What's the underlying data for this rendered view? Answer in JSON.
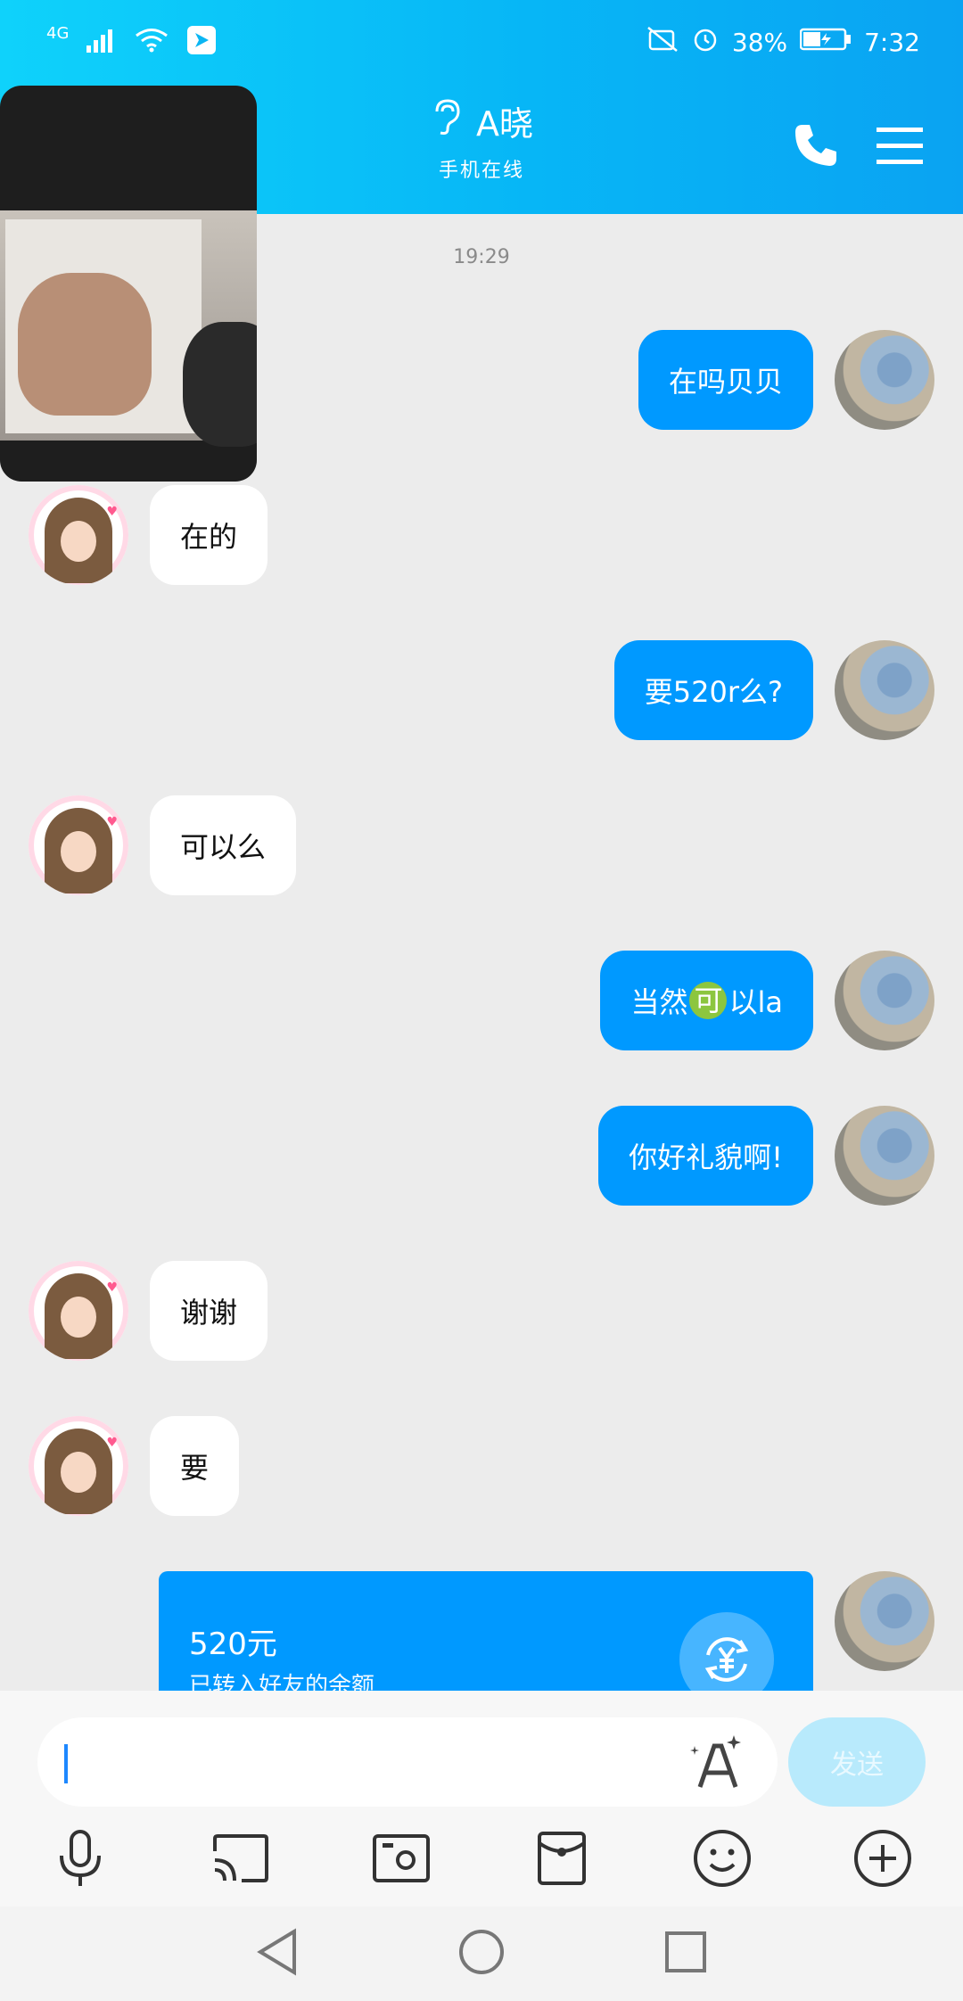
{
  "status_bar": {
    "network": "4G",
    "battery": "38%",
    "time": "7:32"
  },
  "header": {
    "contact_name": "A晓",
    "status": "手机在线",
    "icons": [
      "ear-icon",
      "phone-icon",
      "menu-icon"
    ]
  },
  "chat": {
    "timestamp": "19:29",
    "messages": [
      {
        "from": "me",
        "text": "在吗贝贝"
      },
      {
        "from": "friend",
        "text": "在的"
      },
      {
        "from": "me",
        "text": "要520r么?"
      },
      {
        "from": "friend",
        "text": "可以么"
      },
      {
        "from": "me",
        "text_before": "当然",
        "emoji_char": "可",
        "text_after": "以la"
      },
      {
        "from": "me",
        "text": "你好礼貌啊!"
      },
      {
        "from": "friend",
        "text": "谢谢"
      },
      {
        "from": "friend",
        "text": "要"
      }
    ],
    "transfer": {
      "amount": "520元",
      "description": "已转入好友的余额"
    }
  },
  "input": {
    "value": "",
    "send_label": "发送"
  },
  "toolbar": {
    "icons": [
      "microphone-icon",
      "screen-cast-icon",
      "photo-icon",
      "red-packet-icon",
      "emoji-icon",
      "plus-icon"
    ]
  },
  "navbar": {
    "icons": [
      "back-icon",
      "home-icon",
      "recents-icon"
    ]
  },
  "colors": {
    "header_gradient_start": "#0fd2fb",
    "header_gradient_end": "#0aa3f2",
    "my_bubble": "#0099ff",
    "friend_bubble": "#ffffff",
    "chat_background": "#ececec",
    "send_button": "#b8eafc"
  }
}
